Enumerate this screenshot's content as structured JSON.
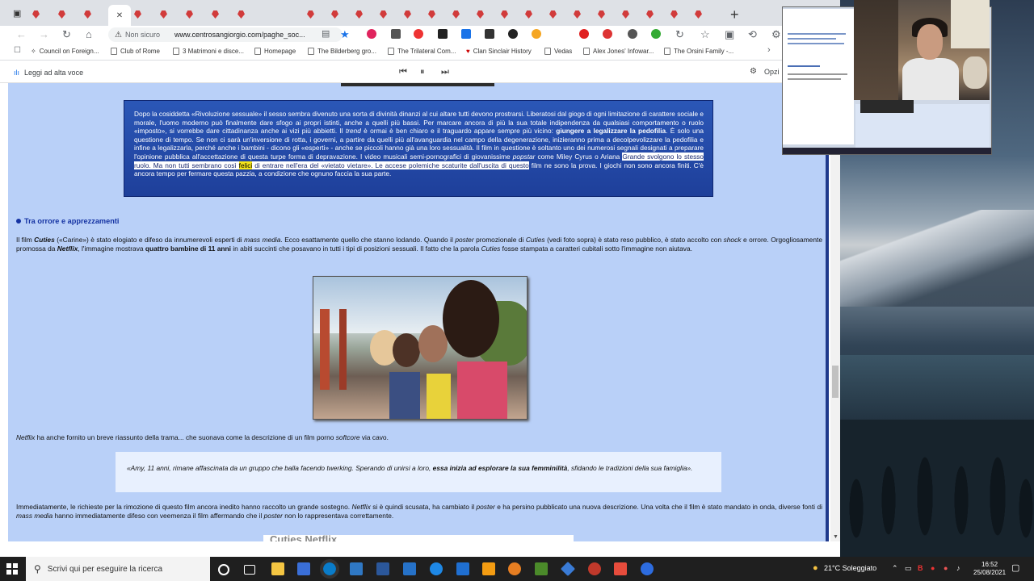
{
  "browser": {
    "address": {
      "security_label": "Non sicuro",
      "url": "www.centrosangiorgio.com/paghe_soc..."
    },
    "bookmarks": [
      "Council on Foreign...",
      "Club of Rome",
      "3 Matrimoni e disce...",
      "Homepage",
      "The Bilderberg gro...",
      "The Trilateral Com...",
      "Clan Sinclair History",
      "Vedas",
      "Alex Jones' Infowar...",
      "The Orsini Family -..."
    ],
    "reader": {
      "label": "Leggi ad alta voce",
      "options_label": "Opzi"
    }
  },
  "article": {
    "quote_parts": [
      "Dopo la cosiddetta «Rivoluzione sessuale» il sesso sembra divenuto una sorta di divinità dinanzi al cui altare tutti devono prostrarsi. Liberatosi dal giogo di ogni limitazione di carattere sociale e morale, l'uomo moderno può finalmente dare sfogo ai propri istinti, anche a quelli più bassi. Per marcare ancora di più la sua totale indipendenza da qualsiasi comportamento o ruolo «imposto», si vorrebbe dare cittadinanza anche ai vizi più abbietti. Il ",
      "trend",
      " è ormai è ben chiaro e il traguardo appare sempre più vicino: ",
      "giungere a legalizzare la pedofilia",
      ". È solo una questione di tempo. Se non ci sarà un'inversione di rotta, i governi, a partire da quelli più all'avanguardia nel campo della degenerazione, inizieranno prima a decolpevolizzare la pedofilia e infine a legalizzarla, perché anche i bambini - dicono gli «esperti» - anche se piccoli hanno già una loro sessualità. Il film in questione è soltanto uno dei numerosi segnali designati a preparare l'opinione pubblica all'accettazione di questa turpe forma di depravazione. I video musicali semi-pornografici di giovanissime ",
      "popstar",
      " come Miley Cyrus o Ariana ",
      "Grande svolgono lo stesso ruolo. Ma non tutti sembrano così ",
      "felici",
      " di entrare nell'era del «vietato vietare». Le accese polemiche scaturite dall'uscita di questo",
      " film ne sono la prova. I giochi non sono ancora finiti. C'è ancora tempo per fermare questa pazzia, a condizione che ognuno faccia la sua parte."
    ],
    "section_title": "Tra orrore e apprezzamenti",
    "p1": [
      "Il film ",
      "Cuties",
      " («Carine») è stato elogiato e difeso da innumerevoli esperti di ",
      "mass media",
      ". Ecco esattamente quello che stanno lodando. Quando il ",
      "poster",
      " promozionale di ",
      "Cuties",
      " (vedi foto sopra) è stato reso pubblico, è stato accolto con ",
      "shock",
      " e orrore. Orgogliosamente promossa da ",
      "Netflix",
      ", l'immagine mostrava ",
      "quattro bambine di 11 anni",
      " in abiti succinti che posavano in tutti i tipi di posizioni sessuali. Il fatto che la parola ",
      "Cuties",
      " fosse stampata a caratteri cubitali sotto l'immagine non aiutava."
    ],
    "p2": [
      "Netflix",
      " ha anche fornito un breve riassunto della trama... che suonava come la descrizione di un film porno ",
      "softcore",
      " via cavo."
    ],
    "blockquote": [
      "«Amy, 11 anni, rimane affascinata da un gruppo che balla facendo twerking. Sperando di unirsi a loro, ",
      "essa inizia ad esplorare la sua femminilità",
      ", sfidando le tradizioni della sua famiglia»."
    ],
    "p3": [
      "Immediatamente, le richieste per la rimozione di questo film ancora inedito hanno raccolto un grande sostegno. ",
      "Netflix",
      " si è quindi scusata, ha cambiato il ",
      "poster",
      " e ha persino pubblicato una nuova descrizione. Una volta che il film è stato mandato in onda, diverse fonti di ",
      "mass media",
      " hanno immediatamente difeso con veemenza il film affermando che il ",
      "poster",
      " non lo rappresentava correttamente."
    ],
    "bottom_title": "Cuties Netflix..."
  },
  "taskbar": {
    "search_placeholder": "Scrivi qui per eseguire la ricerca",
    "weather": "21°C Soleggiato",
    "time": "16:52",
    "date": "25/08/2021"
  },
  "colors": {
    "page_bg": "#b9d0f8",
    "quote_bg": "#2250b0",
    "accent": "#1533a3",
    "highlight": "#f6e61a"
  }
}
